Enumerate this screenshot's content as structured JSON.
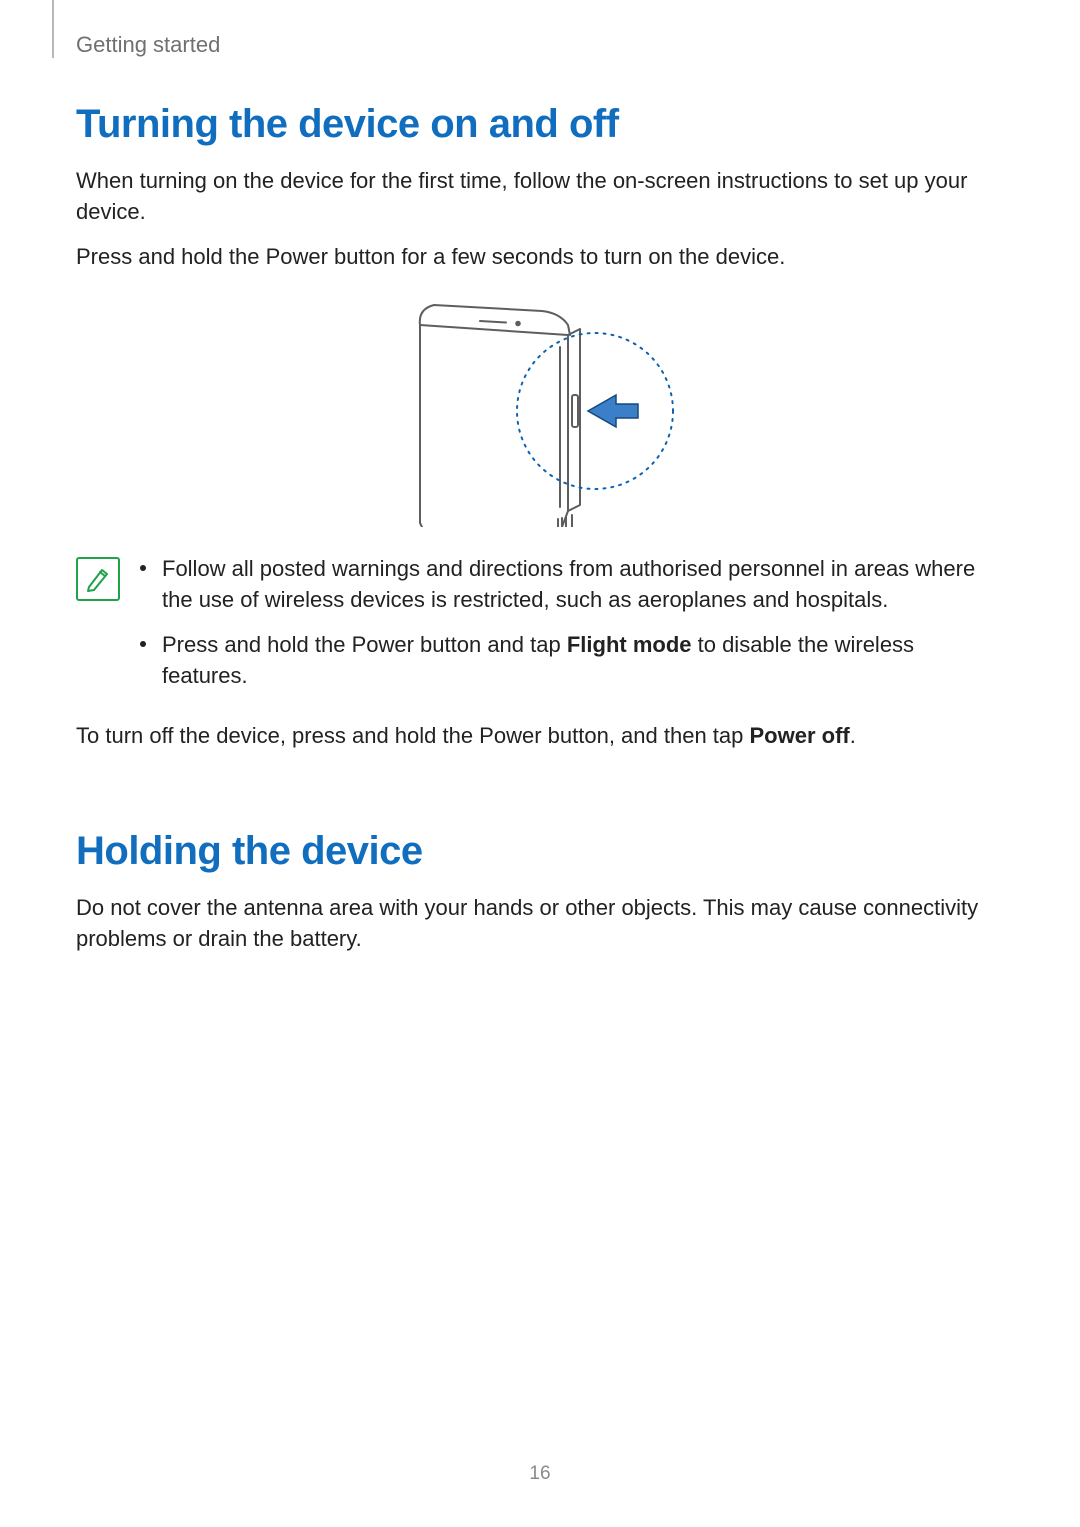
{
  "header": {
    "chapter": "Getting started"
  },
  "section1": {
    "title": "Turning the device on and off",
    "p1": "When turning on the device for the first time, follow the on-screen instructions to set up your device.",
    "p2": "Press and hold the Power button for a few seconds to turn on the device.",
    "note_bullets": {
      "b1": "Follow all posted warnings and directions from authorised personnel in areas where the use of wireless devices is restricted, such as aeroplanes and hospitals.",
      "b2_prefix": "Press and hold the Power button and tap ",
      "b2_bold": "Flight mode",
      "b2_suffix": " to disable the wireless features."
    },
    "p3_prefix": "To turn off the device, press and hold the Power button, and then tap ",
    "p3_bold": "Power off",
    "p3_suffix": "."
  },
  "section2": {
    "title": "Holding the device",
    "p1": "Do not cover the antenna area with your hands or other objects. This may cause connectivity problems or drain the battery."
  },
  "page_number": "16"
}
